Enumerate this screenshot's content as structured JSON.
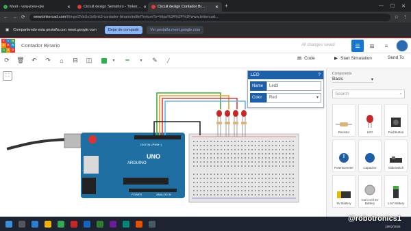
{
  "browser": {
    "tabs": [
      {
        "label": "Meet - vwq-jnew-qiw",
        "active": false,
        "color": "#34a853"
      },
      {
        "label": "Circuit design Semáforo - Tinker…",
        "active": false,
        "color": "#e53935"
      },
      {
        "label": "Circuit design Contador Bi…",
        "active": true,
        "color": "#e53935"
      }
    ],
    "url_domain": "www.tinkercad.com",
    "url_rest": "/things/2VaUs1o6mk3-contador-binario/editel?returnTo=https%3A%2F%2Fwww.tinkercad...",
    "share_text": "Compartiendo esta pestaña con meet.google.com",
    "stop_share": "Dejar de compartir",
    "switch_share": "Ver pestaña meet.google.com"
  },
  "app": {
    "logo_letters": [
      "T",
      "I",
      "N",
      "K",
      "E",
      "R",
      "C",
      "A",
      "D"
    ],
    "project_name": "Contador Binario",
    "saved_status": "All changes saved",
    "code_label": "Code",
    "sim_label": "Start Simulation",
    "send_label": "Send To"
  },
  "inspector": {
    "title": "LED",
    "name_label": "Name",
    "name_value": "Led3",
    "color_label": "Color",
    "color_value": "Red"
  },
  "components_panel": {
    "label": "Components",
    "selected": "Basic",
    "search_placeholder": "Search",
    "items": [
      {
        "name": "Resistor"
      },
      {
        "name": "LED"
      },
      {
        "name": "Pushbutton"
      },
      {
        "name": "Potentiometer"
      },
      {
        "name": "Capacitor"
      },
      {
        "name": "Slideswitch"
      },
      {
        "name": "9V Battery"
      },
      {
        "name": "Coin Cell 3V Battery"
      },
      {
        "name": "1.5V Battery"
      }
    ]
  },
  "board": {
    "brand": "ARDUINO",
    "model": "UNO",
    "digital_label": "DIGITAL (PWM~)",
    "power_label": "POWER",
    "analog_label": "ANALOG IN"
  },
  "overlay": {
    "watermark": "@robotronics1",
    "date": "18/02/2025"
  },
  "colors": {
    "accent": "#1477d2",
    "board": "#1f6fa3",
    "wire_green": "#3fae3a",
    "wire_orange": "#f29b1d",
    "wire_red": "#e53935",
    "wire_blue": "#64b5f6"
  }
}
